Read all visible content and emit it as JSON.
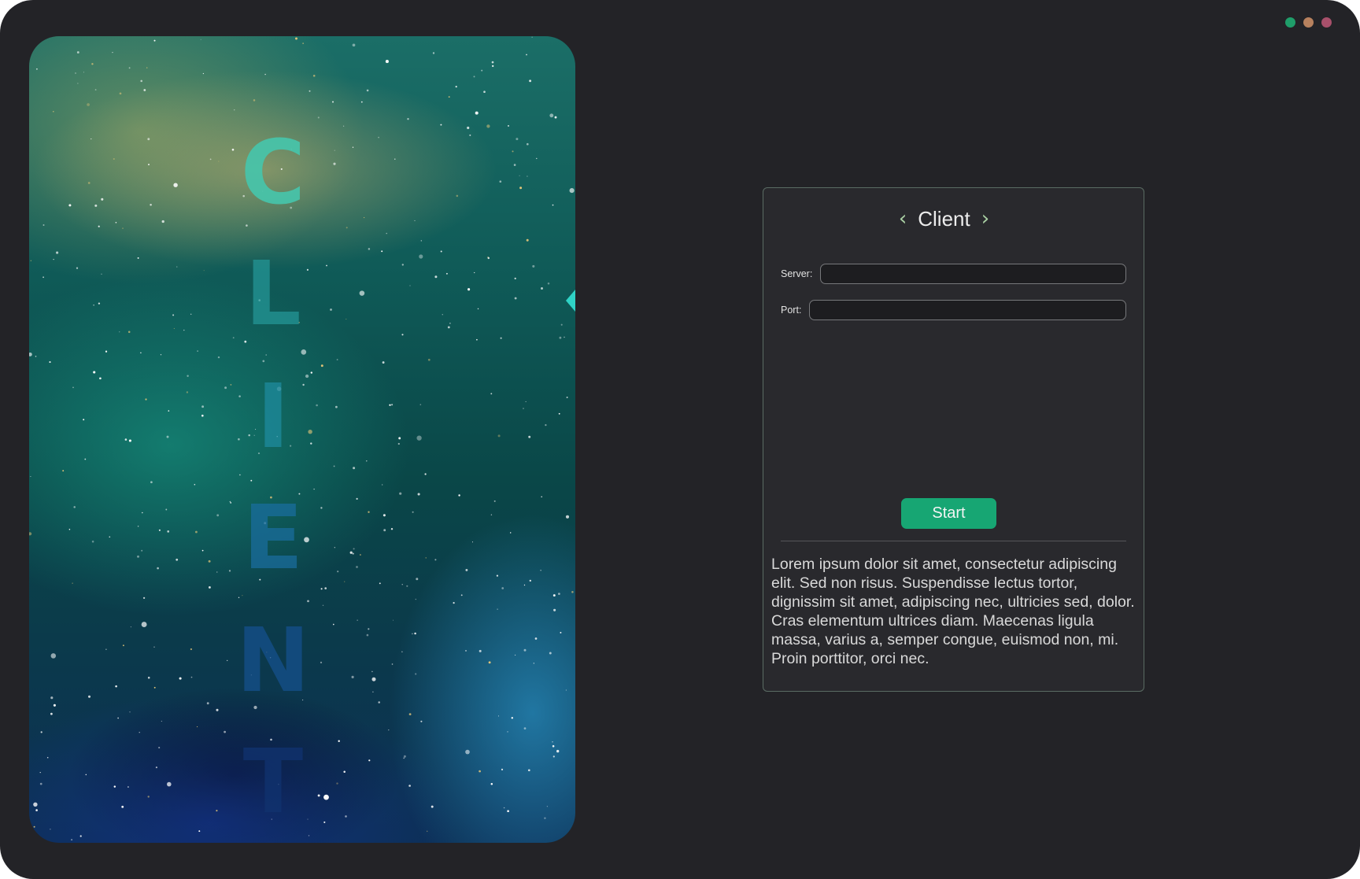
{
  "window": {
    "controls": [
      {
        "name": "close",
        "color": "#1f9e6a"
      },
      {
        "name": "minimize",
        "color": "#b7815e"
      },
      {
        "name": "maximize",
        "color": "#a8506b"
      }
    ]
  },
  "hero": {
    "letters": [
      "C",
      "L",
      "I",
      "E",
      "N",
      "T"
    ]
  },
  "form": {
    "title": "Client",
    "prev_icon": "chevron-left-icon",
    "next_icon": "chevron-right-icon",
    "server_label": "Server:",
    "server_value": "",
    "port_label": "Port:",
    "port_value": "",
    "start_label": "Start",
    "description": "Lorem ipsum dolor sit amet, consectetur adipiscing elit. Sed non risus. Suspendisse lectus tortor, dignissim sit amet, adipiscing nec, ultricies sed, dolor. Cras elementum ultrices diam. Maecenas ligula massa, varius a, semper congue, euismod non, mi. Proin porttitor, orci nec."
  },
  "colors": {
    "window_bg": "#232327",
    "accent": "#17a673",
    "card_border": "#5a6b63",
    "chevron": "#a9cfa3"
  }
}
